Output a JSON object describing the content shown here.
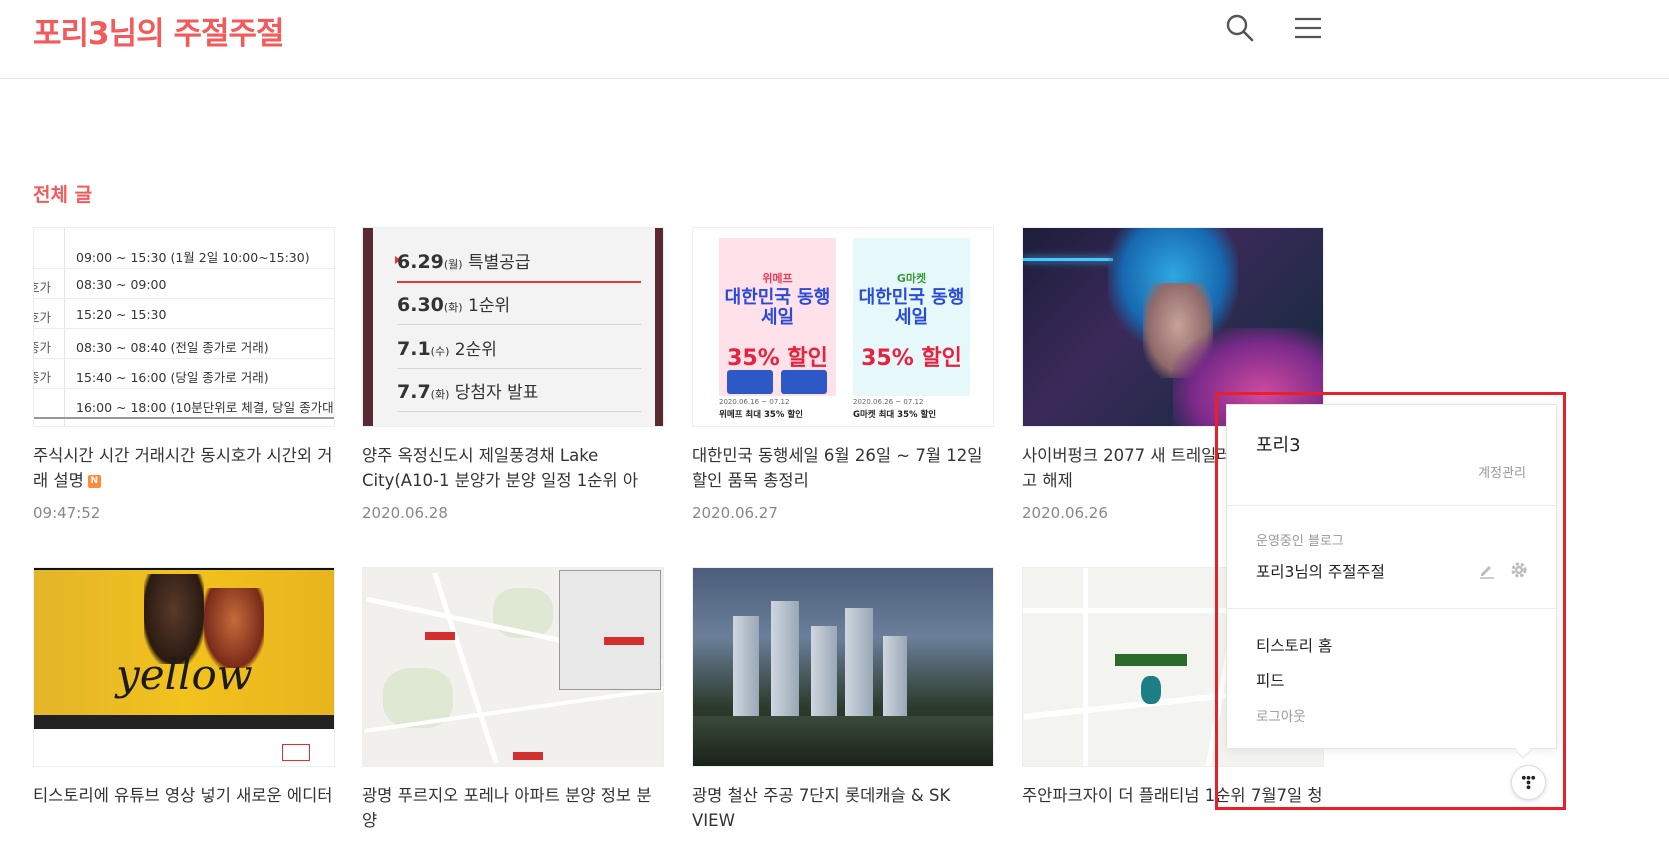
{
  "header": {
    "blog_title": "포리3님의 주절주절",
    "icons": [
      "search-icon",
      "hamburger-menu-icon"
    ]
  },
  "section_title": "전체 글",
  "posts": [
    {
      "title": "주식시간 시간 거래시간 동시호가 시간외 거래 설명",
      "date": "09:47:52",
      "badge": "N",
      "thumb": "stock-trading-hours-table"
    },
    {
      "title": "양주 옥정신도시 제일풍경채 Lake City(A10-1 분양가 분양 일정 1순위 아파…",
      "date": "2020.06.28",
      "thumb": "subscription-schedule"
    },
    {
      "title": "대한민국 동행세일 6월 26일 ~ 7월 12일 할인 품목 총정리",
      "date": "2020.06.27",
      "thumb": "sale-posters"
    },
    {
      "title": "사이버펑크 2077 새 트레일러 와이어 엠바고 해제",
      "date": "2020.06.26",
      "thumb": "cyberpunk-character"
    },
    {
      "title": "티스토리에 유튜브 영상 넣기 새로운 에디터",
      "thumb": "youtube-video-yellow"
    },
    {
      "title": "광명 푸르지오 포레나 아파트 분양 정보 분양",
      "thumb": "location-map"
    },
    {
      "title": "광명 철산 주공 7단지 롯데캐슬 & SK VIEW",
      "thumb": "apartment-night-view"
    },
    {
      "title": "주안파크자이 더 플래티넘 1순위 7월7일 청",
      "thumb": "location-map-marker"
    }
  ],
  "thumb_texts": {
    "stock_rows": [
      {
        "left": "",
        "right": "09:00 ~ 15:30 (1월 2일 10:00~15:30)"
      },
      {
        "left": "호가",
        "right": "08:30 ~ 09:00"
      },
      {
        "left": "호가",
        "right": "15:20 ~ 15:30"
      },
      {
        "left": "종가",
        "right": "08:30 ~ 08:40 (전일 종가로 거래)"
      },
      {
        "left": "종가",
        "right": "15:40 ~ 16:00 (당일 종가로 거래)"
      },
      {
        "left": "",
        "right": "16:00 ~ 18:00 (10분단위로 체결, 당일 종가대비"
      }
    ],
    "schedule": [
      {
        "date": "6.29",
        "day": "(월)",
        "label": "특별공급"
      },
      {
        "date": "6.30",
        "day": "(화)",
        "label": "1순위"
      },
      {
        "date": "7.1",
        "day": "(수)",
        "label": "2순위"
      },
      {
        "date": "7.7",
        "day": "(화)",
        "label": "당첨자 발표"
      }
    ],
    "poster1": {
      "brand": "위메프",
      "headline": "대한민국 동행세일",
      "discount": "35% 할인",
      "date": "2020.06.16 ~ 07.12",
      "caption": "위메프 최대 35% 할인"
    },
    "poster2": {
      "brand": "G마켓",
      "headline": "대한민국 동행세일",
      "discount": "35% 할인",
      "date": "2020.06.26 ~ 07.12",
      "caption": "G마켓 최대 35% 할인"
    },
    "video_word": "yellow"
  },
  "popup": {
    "user_name": "포리3",
    "account_link": "계정관리",
    "section_label": "운영중인 블로그",
    "blog_name": "포리3님의 주절주절",
    "links": [
      "티스토리 홈",
      "피드"
    ],
    "logout": "로그아웃",
    "icons": [
      "pencil-edit-icon",
      "gear-icon",
      "dots-menu-icon"
    ]
  },
  "colors": {
    "accent": "#f45a5a",
    "highlight_border": "#e8202a"
  }
}
